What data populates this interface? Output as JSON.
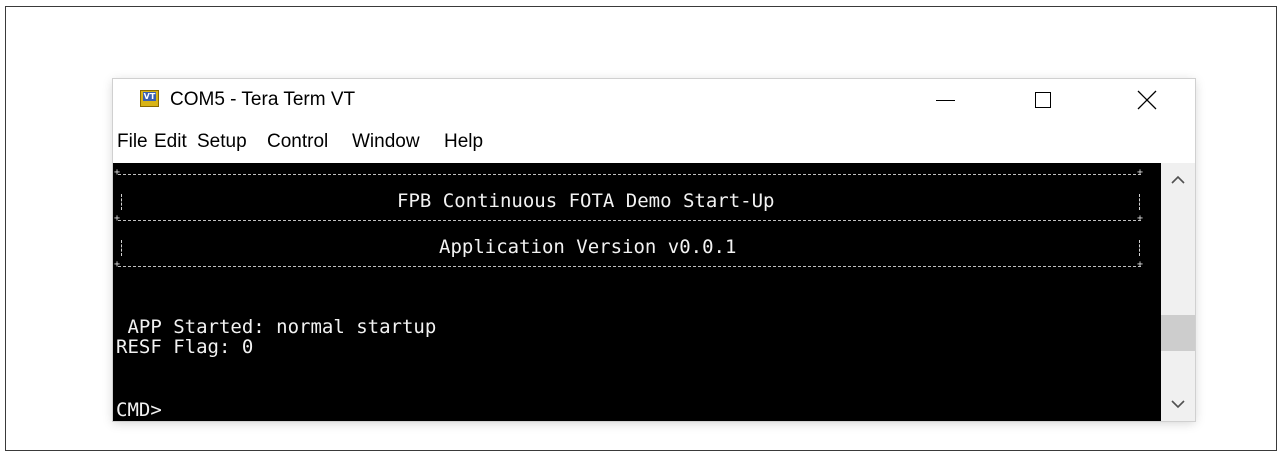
{
  "window": {
    "title": "COM5 - Tera Term VT",
    "icon_label": "VT"
  },
  "menu": {
    "items": [
      {
        "label": "File"
      },
      {
        "label": "Edit"
      },
      {
        "label": "Setup"
      },
      {
        "label": "Control"
      },
      {
        "label": "Window"
      },
      {
        "label": "Help"
      }
    ]
  },
  "terminal": {
    "banner_title": "FPB Continuous FOTA Demo Start-Up",
    "banner_version": "Application Version v0.0.1",
    "app_started": " APP Started: normal startup",
    "resf_flag": "RESF Flag: 0",
    "prompt": "CMD>"
  },
  "icons": {
    "minimize": "minimize-icon",
    "maximize": "maximize-icon",
    "close": "close-icon",
    "scroll_up": "chevron-up-icon",
    "scroll_down": "chevron-down-icon"
  },
  "colors": {
    "terminal_bg": "#000000",
    "terminal_fg": "#f2f2f2",
    "icon_accent": "#d8b417"
  }
}
